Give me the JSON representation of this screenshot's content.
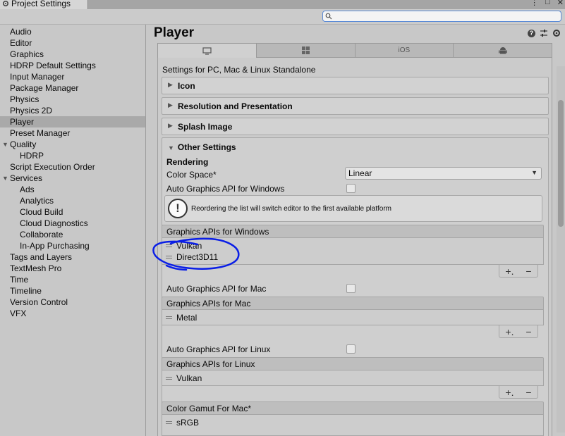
{
  "window": {
    "title": "Project Settings",
    "controls": [
      "⋮",
      "□",
      "✕"
    ]
  },
  "search": {
    "placeholder": ""
  },
  "sidebar": {
    "items": [
      {
        "label": "Audio",
        "indent": 0
      },
      {
        "label": "Editor",
        "indent": 0
      },
      {
        "label": "Graphics",
        "indent": 0
      },
      {
        "label": "HDRP Default Settings",
        "indent": 0
      },
      {
        "label": "Input Manager",
        "indent": 0
      },
      {
        "label": "Package Manager",
        "indent": 0
      },
      {
        "label": "Physics",
        "indent": 0
      },
      {
        "label": "Physics 2D",
        "indent": 0
      },
      {
        "label": "Player",
        "indent": 0,
        "selected": true
      },
      {
        "label": "Preset Manager",
        "indent": 0
      },
      {
        "label": "Quality",
        "indent": 0,
        "expanded": true
      },
      {
        "label": "HDRP",
        "indent": 1
      },
      {
        "label": "Script Execution Order",
        "indent": 0
      },
      {
        "label": "Services",
        "indent": 0,
        "expanded": true
      },
      {
        "label": "Ads",
        "indent": 1
      },
      {
        "label": "Analytics",
        "indent": 1
      },
      {
        "label": "Cloud Build",
        "indent": 1
      },
      {
        "label": "Cloud Diagnostics",
        "indent": 1
      },
      {
        "label": "Collaborate",
        "indent": 1
      },
      {
        "label": "In-App Purchasing",
        "indent": 1
      },
      {
        "label": "Tags and Layers",
        "indent": 0
      },
      {
        "label": "TextMesh Pro",
        "indent": 0
      },
      {
        "label": "Time",
        "indent": 0
      },
      {
        "label": "Timeline",
        "indent": 0
      },
      {
        "label": "Version Control",
        "indent": 0
      },
      {
        "label": "VFX",
        "indent": 0
      }
    ]
  },
  "main": {
    "title": "Player",
    "tabs": [
      {
        "icon": "monitor-icon",
        "label": ""
      },
      {
        "icon": "windows-icon",
        "label": ""
      },
      {
        "icon": "",
        "label": "iOS"
      },
      {
        "icon": "android-icon",
        "label": ""
      }
    ],
    "platform_heading": "Settings for PC, Mac & Linux Standalone",
    "foldouts": [
      "Icon",
      "Resolution and Presentation",
      "Splash Image"
    ],
    "other_settings": {
      "title": "Other Settings",
      "rendering_label": "Rendering",
      "color_space_label": "Color Space*",
      "color_space_value": "Linear",
      "auto_windows_label": "Auto Graphics API  for Windows",
      "warning_text": "Reordering the list will switch editor to the first available platform",
      "windows_list_header": "Graphics APIs for Windows",
      "windows_apis": [
        "Vulkan",
        "Direct3D11"
      ],
      "auto_mac_label": "Auto Graphics API  for Mac",
      "mac_list_header": "Graphics APIs for Mac",
      "mac_apis": [
        "Metal"
      ],
      "auto_linux_label": "Auto Graphics API  for Linux",
      "linux_list_header": "Graphics APIs for Linux",
      "linux_apis": [
        "Vulkan"
      ],
      "gamut_list_header": "Color Gamut For Mac*",
      "gamut_values": [
        "sRGB"
      ]
    },
    "footer_buttons": {
      "add": "+.",
      "remove": "−"
    }
  },
  "annotation": {
    "color": "#0a1ee6"
  }
}
